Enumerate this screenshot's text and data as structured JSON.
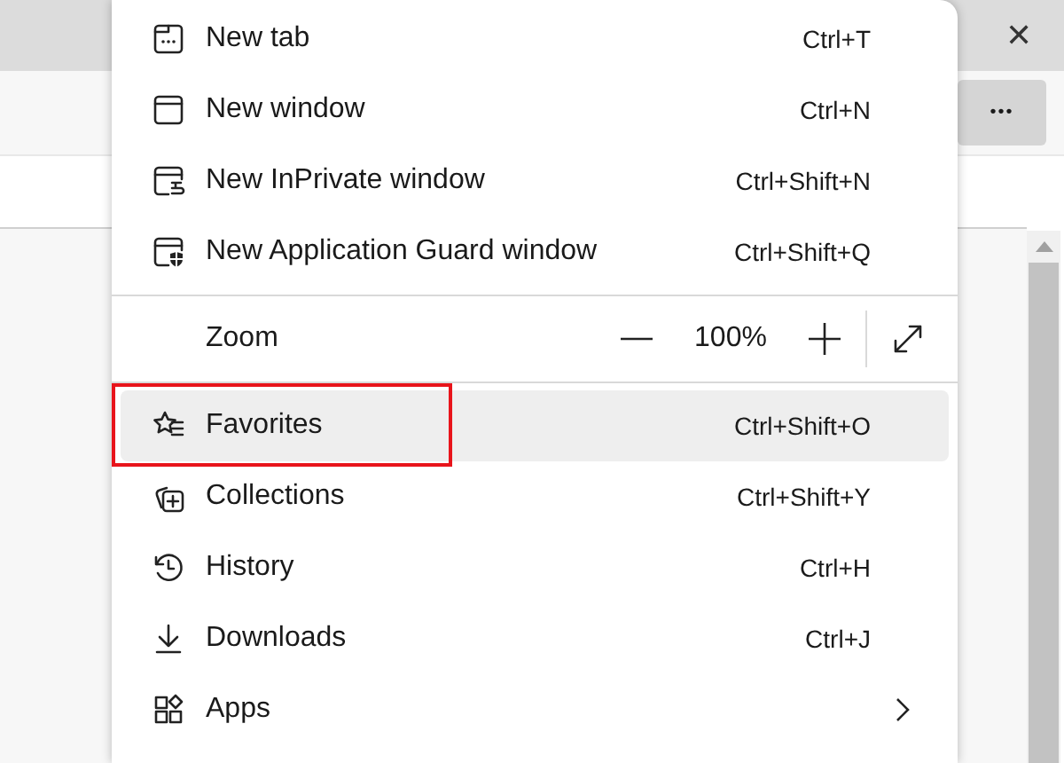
{
  "browser": {
    "close_label": "✕",
    "more_label": "•••"
  },
  "menu": {
    "items": [
      {
        "kind": "command",
        "label": "New tab",
        "shortcut": "Ctrl+T",
        "selected": false
      },
      {
        "kind": "command",
        "label": "New window",
        "shortcut": "Ctrl+N",
        "selected": false
      },
      {
        "kind": "command",
        "label": "New InPrivate window",
        "shortcut": "Ctrl+Shift+N",
        "selected": false
      },
      {
        "kind": "command",
        "label": "New Application Guard window",
        "shortcut": "Ctrl+Shift+Q",
        "selected": false
      },
      {
        "kind": "divider"
      },
      {
        "kind": "zoom",
        "label": "Zoom",
        "value": "100%"
      },
      {
        "kind": "divider"
      },
      {
        "kind": "command",
        "label": "Favorites",
        "shortcut": "Ctrl+Shift+O",
        "selected": true,
        "outlined": true
      },
      {
        "kind": "command",
        "label": "Collections",
        "shortcut": "Ctrl+Shift+Y",
        "selected": false
      },
      {
        "kind": "command",
        "label": "History",
        "shortcut": "Ctrl+H",
        "selected": false
      },
      {
        "kind": "command",
        "label": "Downloads",
        "shortcut": "Ctrl+J",
        "selected": false
      },
      {
        "kind": "submenu",
        "label": "Apps",
        "selected": false
      }
    ]
  }
}
